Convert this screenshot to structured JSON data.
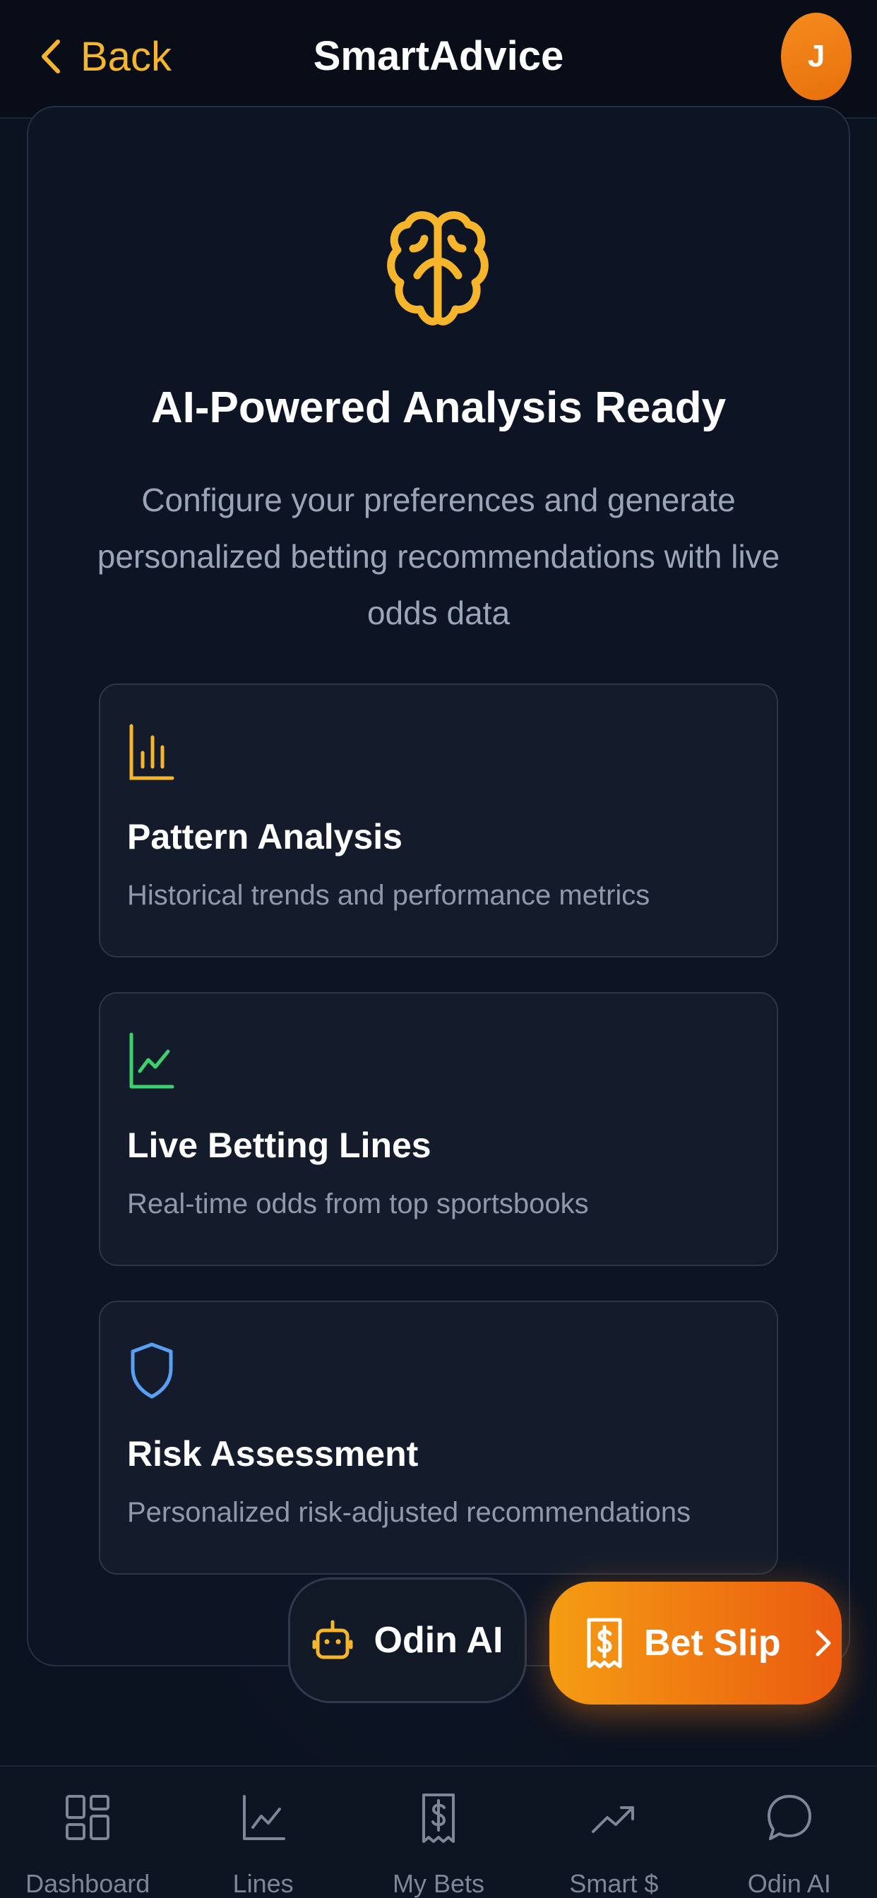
{
  "header": {
    "back_label": "Back",
    "title": "SmartAdvice",
    "avatar_initial": "J"
  },
  "hero": {
    "icon": "brain-icon",
    "heading": "AI-Powered Analysis Ready",
    "description": "Configure your preferences and generate personalized betting recommendations with live odds data"
  },
  "features": [
    {
      "icon": "bar-chart-icon",
      "title": "Pattern Analysis",
      "description": "Historical trends and performance metrics",
      "color": "#f7b52b"
    },
    {
      "icon": "line-chart-icon",
      "title": "Live Betting Lines",
      "description": "Real-time odds from top sportsbooks",
      "color": "#3ecf6e"
    },
    {
      "icon": "shield-icon",
      "title": "Risk Assessment",
      "description": "Personalized risk-adjusted recommendations",
      "color": "#5aa0f2"
    }
  ],
  "floating": {
    "odin_label": "Odin AI",
    "bet_slip_label": "Bet Slip"
  },
  "nav": {
    "items": [
      {
        "label": "Dashboard",
        "icon": "grid-icon"
      },
      {
        "label": "Lines",
        "icon": "line-chart-icon"
      },
      {
        "label": "My Bets",
        "icon": "receipt-icon"
      },
      {
        "label": "Smart $",
        "icon": "trending-up-icon"
      },
      {
        "label": "Odin AI",
        "icon": "chat-bubble-icon"
      }
    ]
  },
  "colors": {
    "accent": "#f7b52b",
    "orange": "#ea5a10",
    "background": "#0b1220"
  }
}
